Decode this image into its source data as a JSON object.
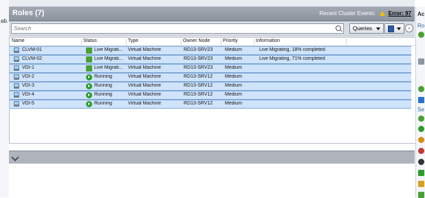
{
  "left_strip": {
    "text": "ab."
  },
  "roles": {
    "title": "Roles (7)",
    "events_label": "Recent Cluster Events:",
    "events_error": "Error: 97",
    "search_placeholder": "Search",
    "queries_label": "Queries",
    "columns": [
      "Name",
      "Status",
      "Type",
      "Owner Node",
      "Priority",
      "Information"
    ],
    "rows": [
      {
        "name": "CLVM-01",
        "status": "Live Migrati...",
        "type": "Virtual Machine",
        "owner": "RD13-SRV23",
        "priority": "Medium",
        "info": "Live Migrating, 18% completed",
        "status_kind": "live"
      },
      {
        "name": "CLVM-02",
        "status": "Live Migrati...",
        "type": "Virtual Machine",
        "owner": "RD13-SRV23",
        "priority": "Medium",
        "info": "Live Migrating, 71% completed",
        "status_kind": "live"
      },
      {
        "name": "VDI-1",
        "status": "Live Migrati...",
        "type": "Virtual Machine",
        "owner": "RD13-SRV23",
        "priority": "Medium",
        "info": "",
        "status_kind": "live"
      },
      {
        "name": "VDI-2",
        "status": "Running",
        "type": "Virtual Machine",
        "owner": "RD13-SRV12",
        "priority": "Medium",
        "info": "",
        "status_kind": "run"
      },
      {
        "name": "VDI-3",
        "status": "Running",
        "type": "Virtual Machine",
        "owner": "RD13-SRV12",
        "priority": "Medium",
        "info": "",
        "status_kind": "run"
      },
      {
        "name": "VDI-4",
        "status": "Running",
        "type": "Virtual Machine",
        "owner": "RD13-SRV12",
        "priority": "Medium",
        "info": "",
        "status_kind": "run"
      },
      {
        "name": "VDI-5",
        "status": "Running",
        "type": "Virtual Machine",
        "owner": "RD13-SRV12",
        "priority": "Medium",
        "info": "",
        "status_kind": "run"
      }
    ]
  },
  "right_pane": {
    "header": "Ac",
    "label_1": "Ro",
    "label_2": "Se"
  },
  "colors": {
    "selected_row": "#cfe4fb",
    "selected_border": "#7fa7d8",
    "header_bg": "#8b939e"
  },
  "icons": {
    "vm": "virtual-machine-icon",
    "live": "live-migration-icon",
    "running": "running-icon",
    "search": "search-icon",
    "save": "save-icon",
    "collapse": "collapse-icon"
  }
}
